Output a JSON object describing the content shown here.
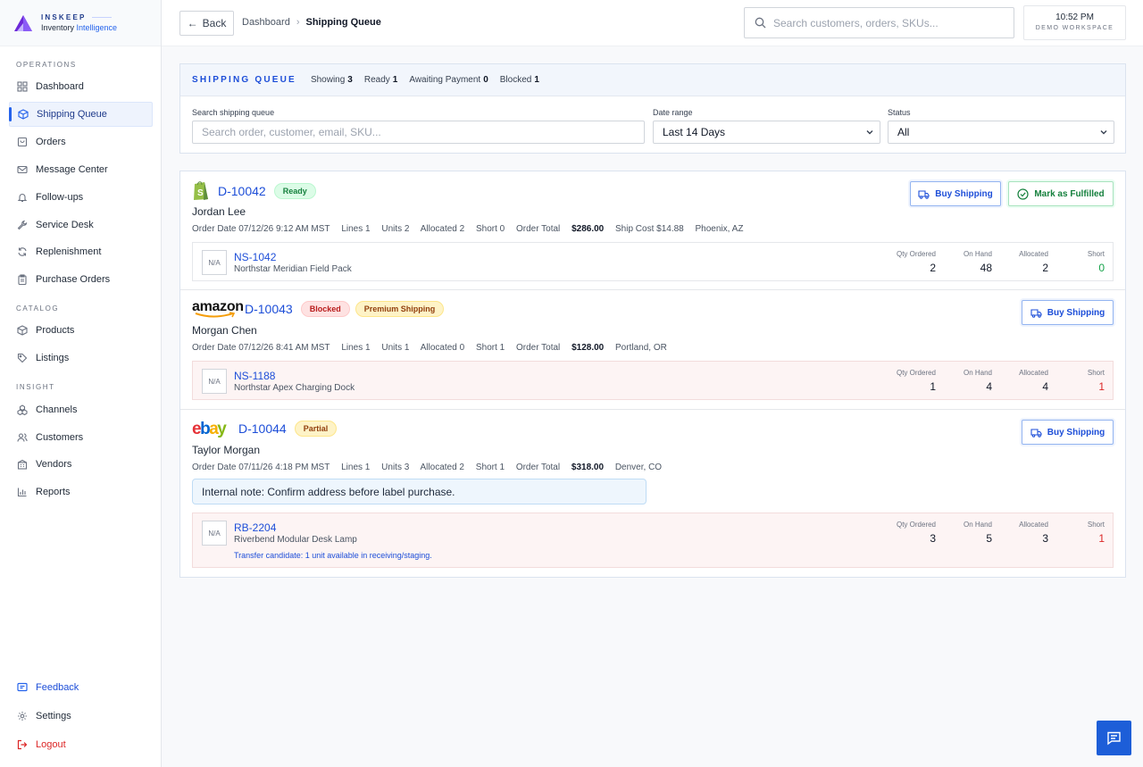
{
  "brand": {
    "name": "INSKEEP",
    "sub_a": "Inventory ",
    "sub_b": "Intelligence"
  },
  "nav": {
    "section_operations": "OPERATIONS",
    "section_catalog": "CATALOG",
    "section_insight": "INSIGHT",
    "items": [
      {
        "label": "Dashboard",
        "icon": "grid-icon"
      },
      {
        "label": "Shipping Queue",
        "icon": "box-icon",
        "active": true
      },
      {
        "label": "Orders",
        "icon": "orders-icon"
      },
      {
        "label": "Message Center",
        "icon": "mail-icon"
      },
      {
        "label": "Follow-ups",
        "icon": "bell-icon"
      },
      {
        "label": "Service Desk",
        "icon": "wrench-icon"
      },
      {
        "label": "Replenishment",
        "icon": "refresh-icon"
      },
      {
        "label": "Purchase Orders",
        "icon": "clipboard-icon"
      },
      {
        "label": "Products",
        "icon": "cube-icon"
      },
      {
        "label": "Listings",
        "icon": "tag-icon"
      },
      {
        "label": "Channels",
        "icon": "channels-icon"
      },
      {
        "label": "Customers",
        "icon": "users-icon"
      },
      {
        "label": "Vendors",
        "icon": "building-icon"
      },
      {
        "label": "Reports",
        "icon": "bar-chart-icon"
      }
    ],
    "feedback": "Feedback",
    "settings": "Settings",
    "logout": "Logout"
  },
  "header": {
    "back_label": "Back",
    "breadcrumb_root": "Dashboard",
    "breadcrumb_sep": "›",
    "breadcrumb_current": "Shipping Queue",
    "search_placeholder": "Search customers, orders, SKUs...",
    "time": "10:52 PM",
    "workspace": "DEMO WORKSPACE"
  },
  "queue": {
    "title": "SHIPPING QUEUE",
    "stats": [
      {
        "label": "Showing",
        "value": "3"
      },
      {
        "label": "Ready",
        "value": "1"
      },
      {
        "label": "Awaiting Payment",
        "value": "0"
      },
      {
        "label": "Blocked",
        "value": "1"
      }
    ],
    "search_label": "Search shipping queue",
    "search_placeholder": "Search order, customer, email, SKU...",
    "date_label": "Date range",
    "date_value": "Last 14 Days",
    "status_label": "Status",
    "status_value": "All"
  },
  "metric_labels": {
    "qty": "Qty Ordered",
    "on_hand": "On Hand",
    "allocated": "Allocated",
    "short": "Short"
  },
  "orders": [
    {
      "id": "D-10042",
      "channel": "shopify",
      "status": "Ready",
      "customer": "Jordan Lee",
      "order_date": "Order Date 07/12/26 9:12 AM MST",
      "lines": "Lines 1",
      "units": "Units 2",
      "allocated": "Allocated 2",
      "short": "Short 0",
      "total_label": "Order Total",
      "total": "$286.00",
      "ship_cost": "Ship Cost $14.88",
      "location": "Phoenix, AZ",
      "buy_label": "Buy Shipping",
      "fulfill_label": "Mark as Fulfilled",
      "line_item": {
        "thumb": "N/A",
        "sku": "NS-1042",
        "name": "Northstar Meridian Field Pack",
        "qty": "2",
        "on_hand": "48",
        "allocated": "2",
        "short": "0"
      }
    },
    {
      "id": "D-10043",
      "channel": "amazon",
      "channel_text": "amazon",
      "status": "Blocked",
      "extra_badge": "Premium Shipping",
      "customer": "Morgan Chen",
      "order_date": "Order Date 07/12/26 8:41 AM MST",
      "lines": "Lines 1",
      "units": "Units 1",
      "allocated": "Allocated 0",
      "short": "Short 1",
      "total_label": "Order Total",
      "total": "$128.00",
      "location": "Portland, OR",
      "buy_label": "Buy Shipping",
      "line_item": {
        "thumb": "N/A",
        "sku": "NS-1188",
        "name": "Northstar Apex Charging Dock",
        "qty": "1",
        "on_hand": "4",
        "allocated": "4",
        "short": "1"
      }
    },
    {
      "id": "D-10044",
      "channel": "ebay",
      "status": "Partial",
      "customer": "Taylor Morgan",
      "order_date": "Order Date 07/11/26 4:18 PM MST",
      "lines": "Lines 1",
      "units": "Units 3",
      "allocated": "Allocated 2",
      "short": "Short 1",
      "total_label": "Order Total",
      "total": "$318.00",
      "location": "Denver, CO",
      "buy_label": "Buy Shipping",
      "note": "Internal note: Confirm address before label purchase.",
      "line_item": {
        "thumb": "N/A",
        "sku": "RB-2204",
        "name": "Riverbend Modular Desk Lamp",
        "transfer": "Transfer candidate: 1 unit available in receiving/staging.",
        "qty": "3",
        "on_hand": "5",
        "allocated": "3",
        "short": "1"
      }
    }
  ],
  "colors": {
    "accent": "#1d4ed8",
    "ready": "#15803d",
    "blocked": "#b91c1c",
    "partial": "#92400e"
  }
}
